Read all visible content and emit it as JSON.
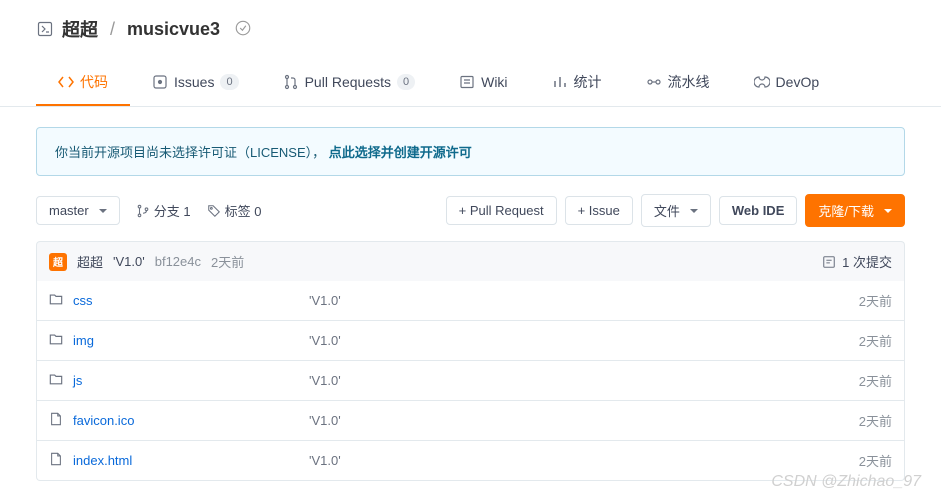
{
  "repo": {
    "owner": "超超",
    "name": "musicvue3"
  },
  "tabs": {
    "code": "代码",
    "issues": "Issues",
    "issues_count": "0",
    "pulls": "Pull Requests",
    "pulls_count": "0",
    "wiki": "Wiki",
    "stats": "统计",
    "pipelines": "流水线",
    "devops": "DevOp"
  },
  "banner": {
    "text": "你当前开源项目尚未选择许可证（LICENSE），",
    "link": "点此选择并创建开源许可"
  },
  "toolbar": {
    "branch": "master",
    "branches": "分支 1",
    "tags": "标签 0",
    "pull_request": "+ Pull Request",
    "issue": "+ Issue",
    "files_btn": "文件",
    "web_ide": "Web IDE",
    "clone": "克隆/下载"
  },
  "summary": {
    "avatar_initial": "超",
    "author": "超超",
    "message": "'V1.0'",
    "hash": "bf12e4c",
    "time": "2天前",
    "commits": "1 次提交"
  },
  "files": [
    {
      "name": "css",
      "type": "dir",
      "msg": "'V1.0'",
      "time": "2天前"
    },
    {
      "name": "img",
      "type": "dir",
      "msg": "'V1.0'",
      "time": "2天前"
    },
    {
      "name": "js",
      "type": "dir",
      "msg": "'V1.0'",
      "time": "2天前"
    },
    {
      "name": "favicon.ico",
      "type": "file",
      "msg": "'V1.0'",
      "time": "2天前"
    },
    {
      "name": "index.html",
      "type": "file",
      "msg": "'V1.0'",
      "time": "2天前"
    }
  ],
  "watermark": "CSDN @Zhichao_97"
}
